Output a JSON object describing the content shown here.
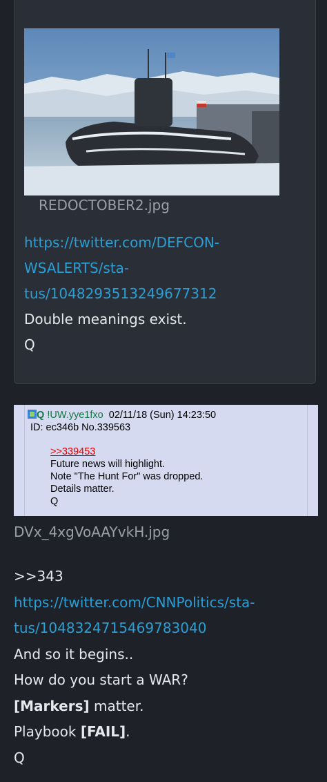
{
  "post1": {
    "image_filename": "REDOCTOBER2.jpg",
    "link_line1": "https://twitter.com/DEFCON-",
    "link_line2": "WSALERTS/sta-",
    "link_line3": "tus/1048293513249677312",
    "text1": "Double meanings exist.",
    "signature": "Q"
  },
  "screenshot": {
    "name": "Q",
    "tripcode": "!UW.yye1fxo",
    "datetime": "02/11/18 (Sun) 14:23:50",
    "id_line": "ID: ec346b No.339563",
    "reply_ref": ">>339453",
    "lines": [
      "Future news will highlight.",
      "Note \"The Hunt For\" was dropped.",
      "Details matter.",
      "Q"
    ]
  },
  "post2": {
    "image_filename": "DVx_4xgVoAAYvkH.jpg",
    "reply": ">>343",
    "link_line1": "https://twitter.com/CNNPolitics/sta-",
    "link_line2": "tus/1048324715469783040",
    "line1": "And so it begins..",
    "line2": "How do you start a WAR?",
    "markers": "[Markers]",
    "markers_rest": " matter.",
    "playbook": "Playbook ",
    "fail": "[FAIL]",
    "fail_rest": ".",
    "signature": "Q"
  },
  "colors": {
    "link": "#2a9fd6",
    "background": "#1e2127",
    "card": "#2a2e36"
  }
}
